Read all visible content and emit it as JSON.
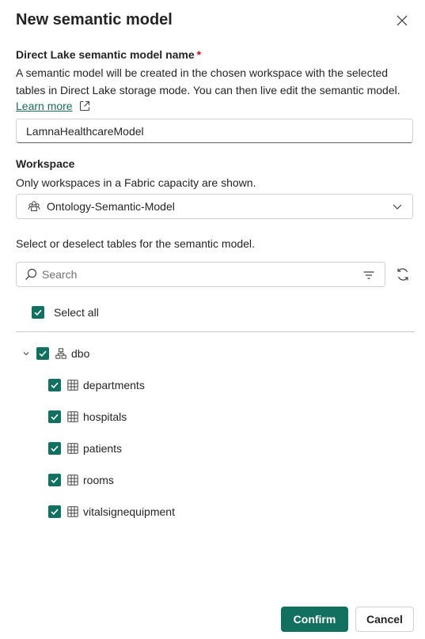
{
  "dialog": {
    "title": "New semantic model"
  },
  "name_field": {
    "label": "Direct Lake semantic model name",
    "required_marker": "*",
    "description": "A semantic model will be created in the chosen workspace with the selected tables in Direct Lake storage mode. You can then live edit the semantic model.",
    "learn_more": "Learn more",
    "value": "LamnaHealthcareModel"
  },
  "workspace": {
    "label": "Workspace",
    "description": "Only workspaces in a Fabric capacity are shown.",
    "selected": "Ontology-Semantic-Model"
  },
  "tables": {
    "instruction": "Select or deselect tables for the semantic model.",
    "search_placeholder": "Search",
    "select_all_label": "Select all",
    "schema": {
      "name": "dbo",
      "items": [
        {
          "name": "departments"
        },
        {
          "name": "hospitals"
        },
        {
          "name": "patients"
        },
        {
          "name": "rooms"
        },
        {
          "name": "vitalsignequipment"
        }
      ]
    }
  },
  "footer": {
    "confirm_label": "Confirm",
    "cancel_label": "Cancel"
  },
  "colors": {
    "accent": "#11705f",
    "required": "#c50f1f"
  }
}
